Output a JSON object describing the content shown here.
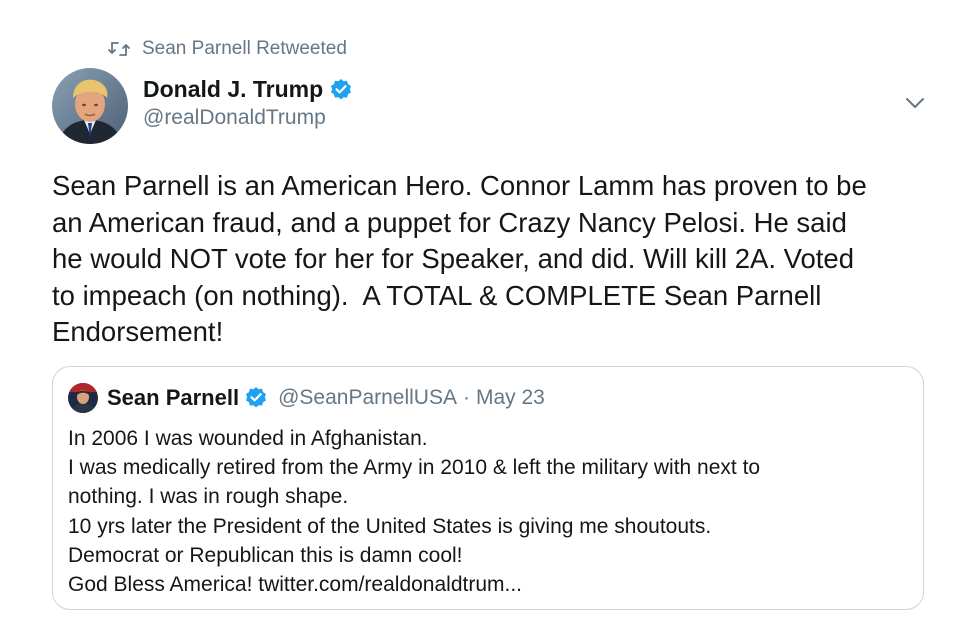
{
  "retweet": {
    "icon": "retweet-icon",
    "label": "Sean Parnell Retweeted"
  },
  "author": {
    "name": "Donald J. Trump",
    "handle": "@realDonaldTrump",
    "verified": true,
    "avatar": "avatar-photo"
  },
  "menu": {
    "icon": "chevron-down-icon"
  },
  "tweet": {
    "lines": [
      "Sean Parnell is an American Hero. Connor Lamm has proven to be",
      "an American fraud, and a puppet for Crazy Nancy Pelosi. He said",
      "he would NOT vote for her for Speaker, and did. Will kill 2A. Voted",
      "to impeach (on nothing).  A TOTAL & COMPLETE Sean Parnell",
      "Endorsement!"
    ]
  },
  "quote": {
    "name": "Sean Parnell",
    "verified": true,
    "handle": "@SeanParnellUSA",
    "separator": "·",
    "date": "May 23",
    "lines": [
      "In 2006 I was wounded in Afghanistan.",
      "I was medically retired from the Army in 2010 & left the military with next to",
      "nothing. I was in rough shape.",
      "10 yrs later the President of the United States is giving me shoutouts.",
      "Democrat or Republican this is damn cool!",
      "God Bless America! twitter.com/realdonaldtrum..."
    ]
  },
  "colors": {
    "text": "#14171a",
    "secondary": "#657786",
    "verified": "#1da1f2",
    "border": "#ccd6dd"
  }
}
